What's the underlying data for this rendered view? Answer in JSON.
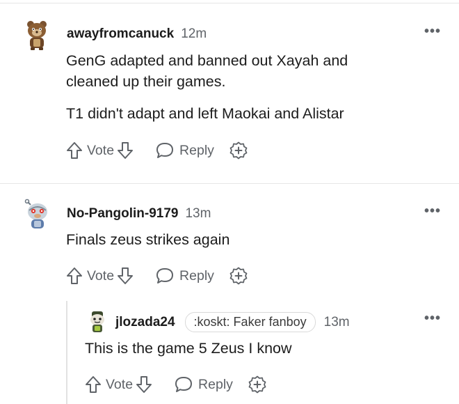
{
  "comments": [
    {
      "username": "awayfromcanuck",
      "time": "12m",
      "paragraphs": [
        "GenG adapted and banned out Xayah and cleaned up their games.",
        "T1 didn't adapt and left Maokai and Alistar"
      ],
      "vote_label": "Vote",
      "reply_label": "Reply"
    },
    {
      "username": "No-Pangolin-9179",
      "time": "13m",
      "paragraphs": [
        "Finals zeus strikes again"
      ],
      "vote_label": "Vote",
      "reply_label": "Reply"
    },
    {
      "username": "jlozada24",
      "flair": ":koskt: Faker fanboy",
      "time": "13m",
      "paragraphs": [
        "This is the game 5 Zeus I know"
      ],
      "vote_label": "Vote",
      "reply_label": "Reply"
    }
  ],
  "more_glyph": "•••",
  "icons": {
    "upvote": "arrow-up-icon",
    "downvote": "arrow-down-icon",
    "reply": "speech-bubble-icon",
    "award": "award-plus-icon",
    "more": "more-options-icon"
  },
  "colors": {
    "text": "#1c1c1c",
    "muted": "#5f6368",
    "divider": "#e6e6e6"
  }
}
